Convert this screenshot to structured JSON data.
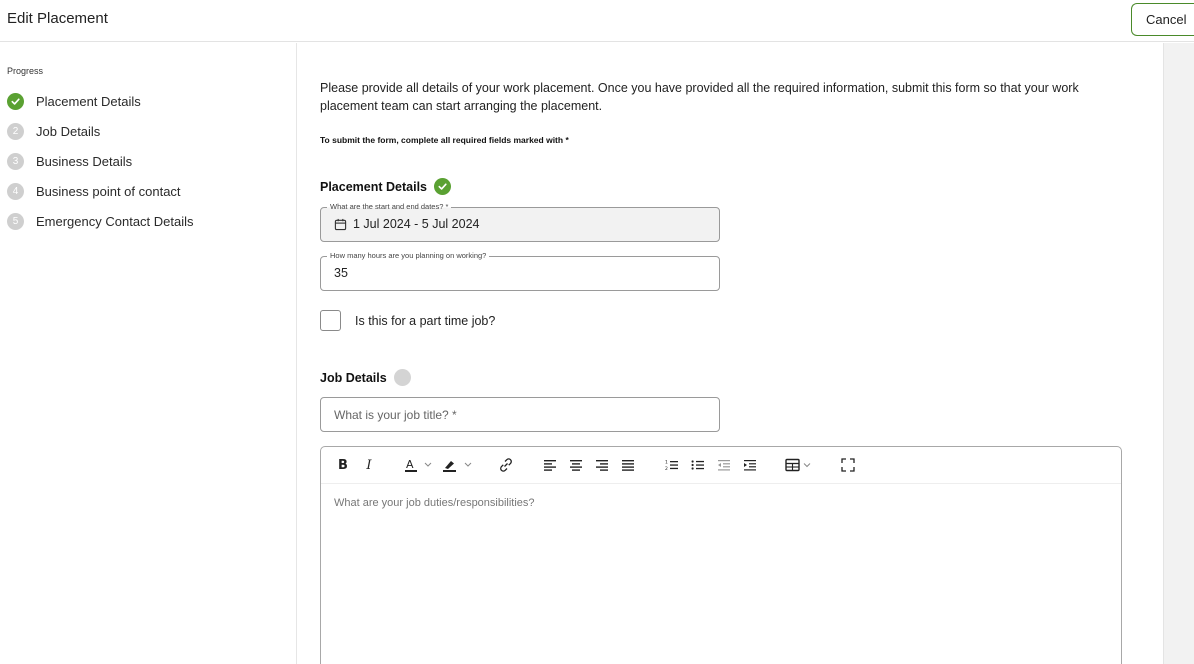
{
  "header": {
    "title": "Edit Placement",
    "cancel_label": "Cancel"
  },
  "sidebar": {
    "progress_label": "Progress",
    "steps": [
      {
        "number": "✓",
        "label": "Placement Details",
        "status": "done"
      },
      {
        "number": "2",
        "label": "Job Details",
        "status": "pending"
      },
      {
        "number": "3",
        "label": "Business Details",
        "status": "pending"
      },
      {
        "number": "4",
        "label": "Business point of contact",
        "status": "pending"
      },
      {
        "number": "5",
        "label": "Emergency Contact Details",
        "status": "pending"
      }
    ]
  },
  "main": {
    "intro": "Please provide all details of your work placement. Once you have provided all the required information, submit this form so that your work placement team can start arranging the placement.",
    "required_note": "To submit the form, complete all required fields marked with *",
    "placement_section": {
      "title": "Placement Details",
      "dates_label": "What are the start and end dates? *",
      "dates_value": "1 Jul 2024 - 5 Jul 2024",
      "hours_label": "How many hours are you planning on working?",
      "hours_value": "35",
      "part_time_label": "Is this for a part time job?"
    },
    "job_section": {
      "title": "Job Details",
      "job_title_placeholder": "What is your job title? *",
      "duties_placeholder": "What are your job duties/responsibilities?"
    }
  },
  "colors": {
    "accent_green": "#5aa132",
    "pending_grey": "#d4d4d4",
    "cancel_border": "#4a8a2a"
  },
  "toolbar_icons": [
    "bold-icon",
    "italic-icon",
    "text-color-icon",
    "highlight-icon",
    "link-icon",
    "align-left-icon",
    "align-center-icon",
    "align-right-icon",
    "justify-icon",
    "ordered-list-icon",
    "bullet-list-icon",
    "outdent-icon",
    "indent-icon",
    "table-icon",
    "fullscreen-icon"
  ]
}
